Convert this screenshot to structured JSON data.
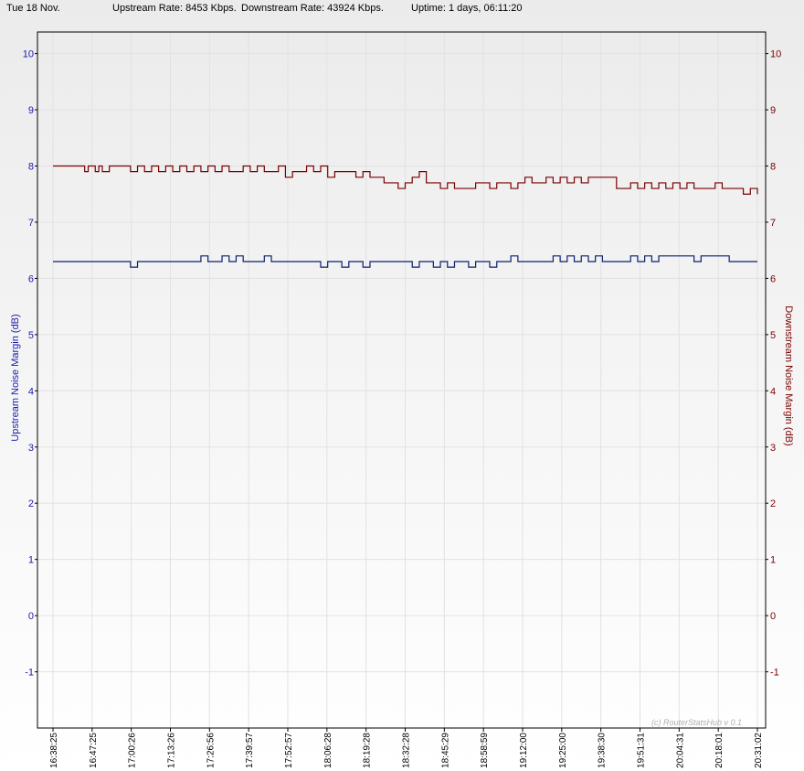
{
  "header": {
    "date": "Tue 18 Nov.",
    "upstream_rate": "Upstream Rate: 8453 Kbps.",
    "downstream_rate": "Downstream Rate: 43924 Kbps.",
    "uptime": "Uptime: 1 days, 06:11:20"
  },
  "credit": "(c) RouterStatsHub v 0.1",
  "colors": {
    "upstream": "#0a1f6e",
    "downstream": "#7a0000",
    "grid": "#e2e2e2"
  },
  "chart_data": {
    "type": "line",
    "ylabel_left": "Upstream Noise Margin (dB)",
    "ylabel_right": "Downstream Noise Margin (dB)",
    "ylim": [
      -2,
      10
    ],
    "yticks": [
      "10",
      "9",
      "8",
      "7",
      "6",
      "5",
      "4",
      "3",
      "2",
      "1",
      "0",
      "-1"
    ],
    "x_ticks": [
      "16:38:25",
      "16:47:25",
      "17:00:26",
      "17:13:26",
      "17:26:56",
      "17:39:57",
      "17:52:57",
      "18:06:28",
      "18:19:28",
      "18:32:28",
      "18:45:29",
      "18:58:59",
      "19:12:00",
      "19:25:00",
      "19:38:30",
      "19:51:31",
      "20:04:31",
      "20:18:01",
      "20:31:02"
    ],
    "grid": true,
    "series": [
      {
        "name": "Upstream Noise Margin (dB)",
        "axis": "left",
        "x": [
          0,
          0.1,
          0.11,
          0.12,
          0.2,
          0.21,
          0.22,
          0.23,
          0.24,
          0.25,
          0.26,
          0.27,
          0.28,
          0.29,
          0.3,
          0.31,
          0.32,
          0.35,
          0.36,
          0.37,
          0.38,
          0.39,
          0.4,
          0.41,
          0.42,
          0.43,
          0.44,
          0.45,
          0.5,
          0.51,
          0.52,
          0.53,
          0.54,
          0.55,
          0.56,
          0.57,
          0.58,
          0.59,
          0.6,
          0.61,
          0.62,
          0.63,
          0.64,
          0.65,
          0.66,
          0.7,
          0.71,
          0.72,
          0.73,
          0.74,
          0.75,
          0.76,
          0.77,
          0.78,
          0.8,
          0.81,
          0.82,
          0.83,
          0.84,
          0.85,
          0.86,
          0.87,
          0.88,
          0.9,
          0.91,
          0.92,
          0.95,
          0.96,
          0.97,
          1.0
        ],
        "y": [
          6.3,
          6.3,
          6.2,
          6.3,
          6.3,
          6.4,
          6.3,
          6.3,
          6.4,
          6.3,
          6.4,
          6.3,
          6.3,
          6.3,
          6.4,
          6.3,
          6.3,
          6.3,
          6.3,
          6.3,
          6.2,
          6.3,
          6.3,
          6.2,
          6.3,
          6.3,
          6.2,
          6.3,
          6.3,
          6.2,
          6.3,
          6.3,
          6.2,
          6.3,
          6.2,
          6.3,
          6.3,
          6.2,
          6.3,
          6.3,
          6.2,
          6.3,
          6.3,
          6.4,
          6.3,
          6.3,
          6.4,
          6.3,
          6.4,
          6.3,
          6.4,
          6.3,
          6.4,
          6.3,
          6.3,
          6.3,
          6.4,
          6.3,
          6.4,
          6.3,
          6.4,
          6.4,
          6.4,
          6.4,
          6.3,
          6.4,
          6.4,
          6.3,
          6.3,
          6.3
        ],
        "color": "#0a1f6e"
      },
      {
        "name": "Downstream Noise Margin (dB)",
        "axis": "right",
        "x": [
          0,
          0.04,
          0.045,
          0.05,
          0.06,
          0.065,
          0.07,
          0.08,
          0.09,
          0.1,
          0.11,
          0.12,
          0.13,
          0.14,
          0.15,
          0.16,
          0.17,
          0.18,
          0.19,
          0.2,
          0.21,
          0.22,
          0.23,
          0.24,
          0.25,
          0.26,
          0.27,
          0.28,
          0.29,
          0.3,
          0.31,
          0.32,
          0.33,
          0.34,
          0.35,
          0.36,
          0.37,
          0.38,
          0.39,
          0.4,
          0.41,
          0.42,
          0.43,
          0.44,
          0.45,
          0.46,
          0.47,
          0.48,
          0.49,
          0.5,
          0.51,
          0.52,
          0.53,
          0.54,
          0.55,
          0.56,
          0.57,
          0.58,
          0.6,
          0.61,
          0.62,
          0.63,
          0.64,
          0.65,
          0.66,
          0.67,
          0.68,
          0.69,
          0.7,
          0.71,
          0.72,
          0.73,
          0.74,
          0.75,
          0.76,
          0.77,
          0.78,
          0.79,
          0.8,
          0.81,
          0.82,
          0.83,
          0.84,
          0.85,
          0.86,
          0.87,
          0.88,
          0.89,
          0.9,
          0.91,
          0.92,
          0.93,
          0.94,
          0.95,
          0.96,
          0.97,
          0.98,
          0.99,
          1.0
        ],
        "y": [
          8.0,
          8.0,
          7.9,
          8.0,
          7.9,
          8.0,
          7.9,
          8.0,
          8.0,
          8.0,
          7.9,
          8.0,
          7.9,
          8.0,
          7.9,
          8.0,
          7.9,
          8.0,
          7.9,
          8.0,
          7.9,
          8.0,
          7.9,
          8.0,
          7.9,
          7.9,
          8.0,
          7.9,
          8.0,
          7.9,
          7.9,
          8.0,
          7.8,
          7.9,
          7.9,
          8.0,
          7.9,
          8.0,
          7.8,
          7.9,
          7.9,
          7.9,
          7.8,
          7.9,
          7.8,
          7.8,
          7.7,
          7.7,
          7.6,
          7.7,
          7.8,
          7.9,
          7.7,
          7.7,
          7.6,
          7.7,
          7.6,
          7.6,
          7.7,
          7.7,
          7.6,
          7.7,
          7.7,
          7.6,
          7.7,
          7.8,
          7.7,
          7.7,
          7.8,
          7.7,
          7.8,
          7.7,
          7.8,
          7.7,
          7.8,
          7.8,
          7.8,
          7.8,
          7.6,
          7.6,
          7.7,
          7.6,
          7.7,
          7.6,
          7.7,
          7.6,
          7.7,
          7.6,
          7.7,
          7.6,
          7.6,
          7.6,
          7.7,
          7.6,
          7.6,
          7.6,
          7.5,
          7.6,
          7.5
        ],
        "color": "#7a0000"
      }
    ]
  }
}
